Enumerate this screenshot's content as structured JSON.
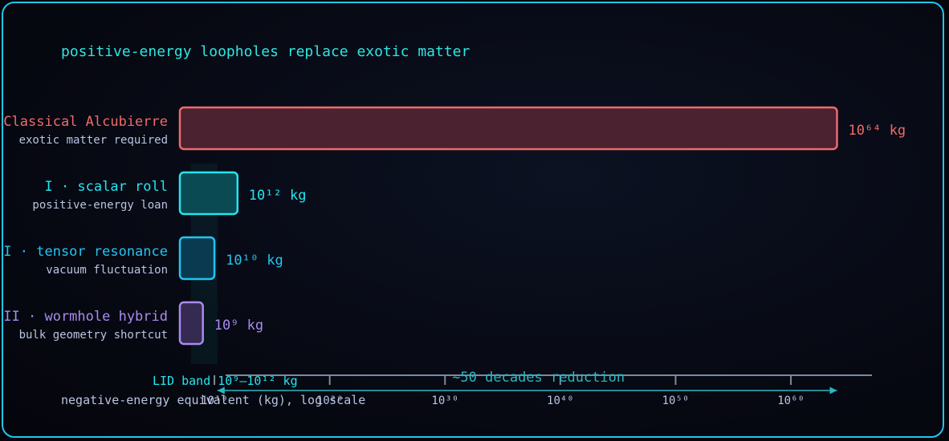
{
  "chart_data": {
    "type": "bar",
    "orientation": "horizontal",
    "title": "positive-energy loopholes replace exotic matter",
    "xlabel": "negative-energy equivalent (kg), log scale",
    "xscale": "log",
    "xlim": [
      10000000.0,
      1e+65
    ],
    "x_ticks": [
      {
        "value": 10000000000.0,
        "label": "10¹⁰"
      },
      {
        "value": 1e+20,
        "label": "10²⁰"
      },
      {
        "value": 1e+30,
        "label": "10³⁰"
      },
      {
        "value": 1e+40,
        "label": "10⁴⁰"
      },
      {
        "value": 1e+50,
        "label": "10⁵⁰"
      },
      {
        "value": 1e+60,
        "label": "10⁶⁰"
      }
    ],
    "categories": [
      {
        "label": "Classical Alcubierre",
        "sublabel": "exotic matter required",
        "value": 1e+64,
        "value_label": "10⁶⁴ kg",
        "color": "#f06a6a",
        "fill": "#4a2230"
      },
      {
        "label": "I · scalar roll",
        "sublabel": "positive-energy loan",
        "value": 1000000000000.0,
        "value_label": "10¹² kg",
        "color": "#22e6f0",
        "fill": "#0a4a52"
      },
      {
        "label": "II · tensor resonance",
        "sublabel": "vacuum fluctuation",
        "value": 10000000000.0,
        "value_label": "10¹⁰ kg",
        "color": "#22c5f0",
        "fill": "#0a3a50"
      },
      {
        "label": "III · wormhole hybrid",
        "sublabel": "bulk geometry shortcut",
        "value": 1000000000.0,
        "value_label": "10⁹ kg",
        "color": "#a98af0",
        "fill": "#342a52"
      }
    ],
    "annotations": [
      {
        "kind": "band",
        "text": "LID band 10⁹–10¹² kg",
        "from": 1000000000.0,
        "to": 1000000000000.0,
        "color": "#22e6f0"
      },
      {
        "kind": "arrow",
        "text": "~50 decades reduction",
        "from": 1000000000000.0,
        "to": 1e+64,
        "color": "#2ab8c0"
      }
    ],
    "colors": {
      "title": "#2ee6e0",
      "axis": "#7a8aa0",
      "tick_label": "#b8c4e0",
      "sublabel": "#b8c4e0"
    }
  }
}
